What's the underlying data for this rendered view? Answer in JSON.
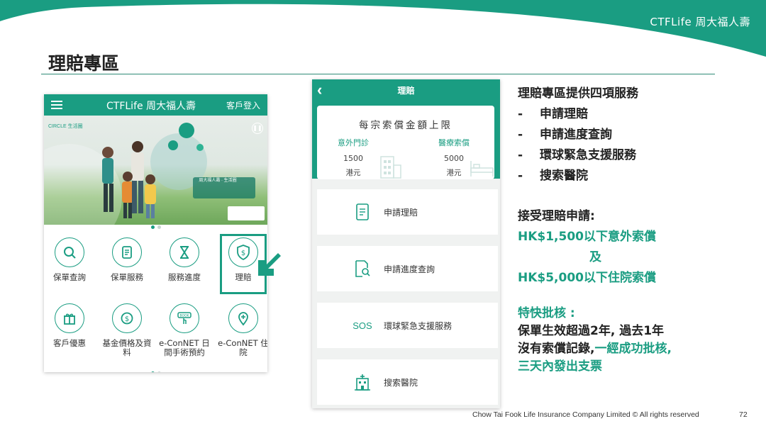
{
  "brand": {
    "logo_text": "CTFLife 周大福人壽"
  },
  "slide": {
    "title": "理賠專區",
    "page_number": "72"
  },
  "footer": {
    "copyright": "Chow Tai Fook Life Insurance Company Limited © All rights reserved"
  },
  "phone_home": {
    "header": {
      "brand": "CTFLife 周大福人壽",
      "login": "客戶登入"
    },
    "banner": {
      "circle_label": "CIRCLE 生活圈",
      "tagline": "周大福人壽 · 生活圈"
    },
    "menu": [
      {
        "label": "保單查詢",
        "icon": "search-icon"
      },
      {
        "label": "保單服務",
        "icon": "document-icon"
      },
      {
        "label": "服務進度",
        "icon": "hourglass-icon"
      },
      {
        "label": "理賠",
        "icon": "shield-dollar-icon"
      },
      {
        "label": "客戶優惠",
        "icon": "gift-icon"
      },
      {
        "label": "基金價格及資料",
        "icon": "dollar-coin-icon"
      },
      {
        "label": "e-ConNET 日間手術預約",
        "icon": "touch-book-icon"
      },
      {
        "label": "e-ConNET 住院",
        "icon": "location-pin-icon"
      }
    ]
  },
  "phone_claims": {
    "header": {
      "title": "理賠"
    },
    "limit_card": {
      "title": "每宗索償金額上限",
      "columns": [
        {
          "heading": "意外門診",
          "amount": "1500",
          "unit": "港元"
        },
        {
          "heading": "醫療索償",
          "amount": "5000",
          "unit": "港元"
        }
      ]
    },
    "services": [
      {
        "label": "申請理賠",
        "icon": "document-icon"
      },
      {
        "label": "申請進度查詢",
        "icon": "document-search-icon"
      },
      {
        "label": "環球緊急支援服務",
        "icon": "sos-icon",
        "icon_text": "SOS"
      },
      {
        "label": "搜索醫院",
        "icon": "hospital-icon"
      }
    ]
  },
  "info": {
    "heading": "理賠專區提供四項服務",
    "services": [
      "申請理賠",
      "申請進度查詢",
      "環球緊急支援服務",
      "搜索醫院"
    ],
    "bullet": "-",
    "accept_heading": "接受理賠申請:",
    "accept_line1": "HK$1,500以下意外索償",
    "accept_and": "及",
    "accept_line2": "HK$5,000以下住院索償",
    "fast_heading": "特快批核 :",
    "fast_line1": "保單生效超過2年, 過去1年",
    "fast_line2_black": "沒有索償記錄,",
    "fast_line2_green": "一經成功批核,",
    "fast_line3": "三天內發出支票"
  },
  "colors": {
    "brand_green": "#1a9d82",
    "text_dark": "#222222"
  }
}
